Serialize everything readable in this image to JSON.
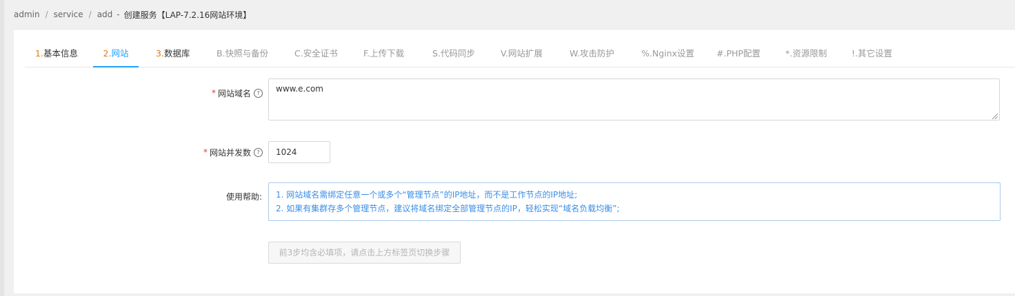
{
  "breadcrumb": {
    "items": [
      "admin",
      "service",
      "add"
    ],
    "separator": "/",
    "dash": "-",
    "title": "创建服务【LAP-7.2.16网站环境】"
  },
  "tabs": [
    {
      "num": "1.",
      "label": "基本信息",
      "required": true,
      "active": false
    },
    {
      "num": "2.",
      "label": "网站",
      "required": true,
      "active": true
    },
    {
      "num": "3.",
      "label": "数据库",
      "required": true,
      "active": false
    },
    {
      "num": "B.",
      "label": "快照与备份",
      "required": false,
      "active": false
    },
    {
      "num": "C.",
      "label": "安全证书",
      "required": false,
      "active": false
    },
    {
      "num": "F.",
      "label": "上传下载",
      "required": false,
      "active": false
    },
    {
      "num": "S.",
      "label": "代码同步",
      "required": false,
      "active": false
    },
    {
      "num": "V.",
      "label": "网站扩展",
      "required": false,
      "active": false
    },
    {
      "num": "W.",
      "label": "攻击防护",
      "required": false,
      "active": false
    },
    {
      "num": "%.",
      "label": "Nginx设置",
      "required": false,
      "active": false
    },
    {
      "num": "#.",
      "label": "PHP配置",
      "required": false,
      "active": false
    },
    {
      "num": "*.",
      "label": "资源限制",
      "required": false,
      "active": false
    },
    {
      "num": "!.",
      "label": "其它设置",
      "required": false,
      "active": false
    }
  ],
  "form": {
    "required_mark": "*",
    "help_icon": "?",
    "domain_label": "网站域名",
    "domain_value": "www.e.com",
    "concurrency_label": "网站并发数",
    "concurrency_value": "1024",
    "help_label": "使用帮助:",
    "help_lines": [
      "1. 网站域名需绑定任意一个或多个“管理节点”的IP地址，而不是工作节点的IP地址;",
      "2. 如果有集群存多个管理节点，建议将域名绑定全部管理节点的IP，轻松实现“域名负载均衡”;"
    ],
    "submit_label": "前3步均含必填项，请点击上方标签页切换步骤"
  },
  "colors": {
    "accent": "#1e9fff",
    "required_num": "#e4780c",
    "required_star": "#e03c3c",
    "help_text": "#3a8ee6"
  }
}
